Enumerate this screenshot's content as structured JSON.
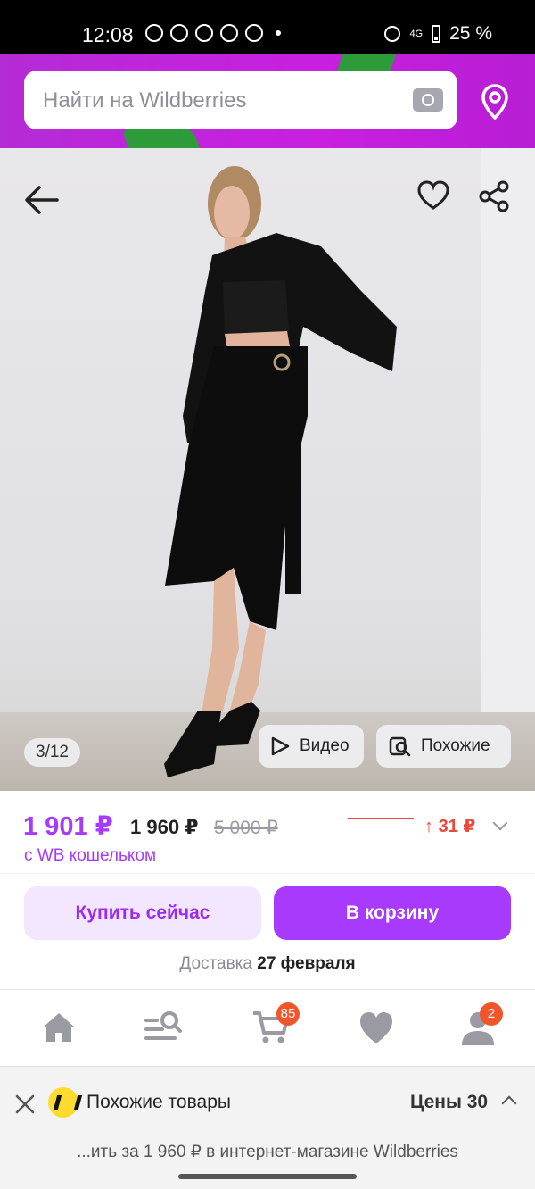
{
  "status_bar": {
    "time": "12:08",
    "network": "4G",
    "battery": "25 %",
    "app_icons": [
      "whatsapp-icon",
      "telegram-icon",
      "heart-app-icon",
      "tiktok-icon",
      "viber-icon"
    ]
  },
  "header": {
    "search_placeholder": "Найти на Wildberries",
    "accent_color": "#c91fe0"
  },
  "product_gallery": {
    "counter": "3/12",
    "video_label": "Видео",
    "similar_label": "Похожие"
  },
  "price": {
    "wallet_price": "1 901 ₽",
    "regular_price": "1 960 ₽",
    "old_price": "5 000 ₽",
    "wallet_note": "с WB кошельком",
    "trend_value": "31 ₽",
    "price_color": "#a73afd",
    "trend_color": "#e8493d"
  },
  "actions": {
    "buy_now": "Купить сейчас",
    "add_to_cart": "В корзину",
    "delivery_label": "Доставка",
    "delivery_date": "27 февраля"
  },
  "tabbar": {
    "cart_badge": "85",
    "profile_badge": "2",
    "icons": [
      "home-icon",
      "catalog-search-icon",
      "cart-icon",
      "favorites-icon",
      "profile-icon"
    ]
  },
  "bottom_panel": {
    "title": "Похожие товары",
    "prices_label": "Цены",
    "prices_count": "30",
    "subtitle": "...ить за 1 960 ₽ в интернет-магазине Wildberries"
  }
}
